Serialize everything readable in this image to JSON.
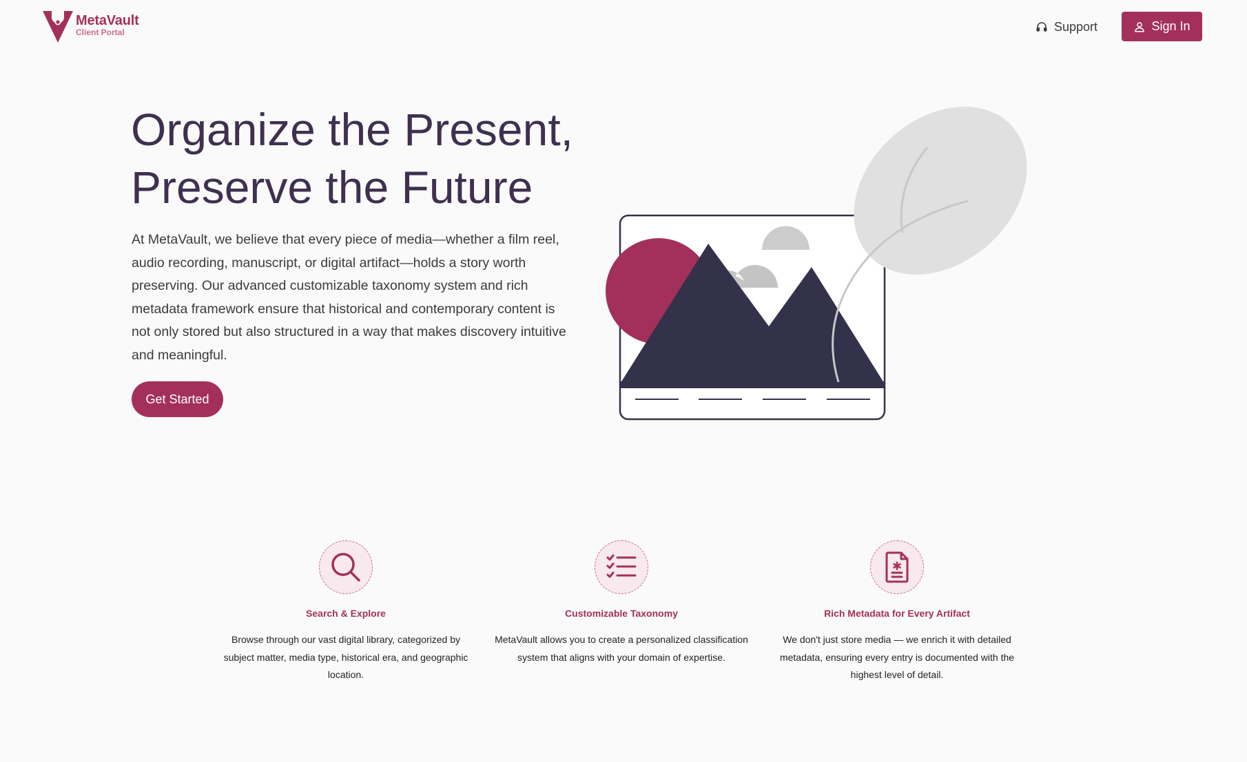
{
  "brand": {
    "name": "MetaVault",
    "subtitle": "Client Portal",
    "accent_color": "#a3305a"
  },
  "nav": {
    "support_label": "Support",
    "support_icon": "headphones-icon",
    "signin_label": "Sign In",
    "signin_icon": "user-icon"
  },
  "hero": {
    "title_line1": "Organize the Present,",
    "title_line2": "Preserve the Future",
    "description": "At MetaVault, we believe that every piece of media—whether a film reel, audio recording, manuscript, or digital artifact—holds a story worth preserving. Our advanced customizable taxonomy system and rich metadata framework ensure that historical and contemporary content is not only stored but also structured in a way that makes discovery intuitive and meaningful.",
    "cta_label": "Get Started",
    "title_color": "#3f3050"
  },
  "features": [
    {
      "icon": "search-icon",
      "title": "Search & Explore",
      "description": "Browse through our vast digital library, categorized by subject matter, media type, historical era, and geographic location."
    },
    {
      "icon": "checklist-icon",
      "title": "Customizable Taxonomy",
      "description": "MetaVault allows you to create a personalized classification system that aligns with your domain of expertise."
    },
    {
      "icon": "document-icon",
      "title": "Rich Metadata for Every Artifact",
      "description": "We don't just store media — we enrich it with detailed metadata, ensuring every entry is documented with the highest level of detail."
    }
  ]
}
